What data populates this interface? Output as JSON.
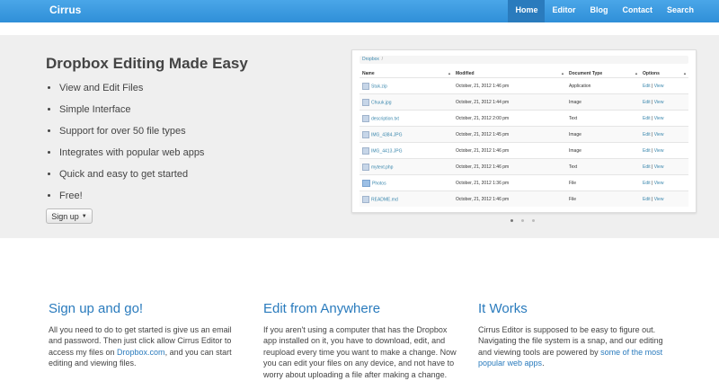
{
  "navbar": {
    "brand": "Cirrus",
    "links": [
      "Home",
      "Editor",
      "Blog",
      "Contact",
      "Search"
    ],
    "active": "Home"
  },
  "hero": {
    "title": "Dropbox Editing Made Easy",
    "features": [
      "View and Edit Files",
      "Simple Interface",
      "Support for over 50 file types",
      "Integrates with popular web apps",
      "Quick and easy to get started",
      "Free!"
    ],
    "signup_label": "Sign up",
    "carousel_active": 1,
    "carousel_count": 3
  },
  "file_browser": {
    "breadcrumb": "Dropbox",
    "columns": [
      "Name",
      "Modified",
      "Document Type",
      "Options"
    ],
    "rows": [
      {
        "name": "Stuk.zip",
        "modified": "October, 21, 2012 1:46 pm",
        "type": "Application",
        "edit": "Edit",
        "view": "View",
        "icon": "file-icon"
      },
      {
        "name": "Chuuk.jpg",
        "modified": "October, 21, 2012 1:44 pm",
        "type": "Image",
        "edit": "Edit",
        "view": "View",
        "icon": "image-icon"
      },
      {
        "name": "description.txt",
        "modified": "October, 21, 2012 2:00 pm",
        "type": "Text",
        "edit": "Edit",
        "view": "View",
        "icon": "file-icon"
      },
      {
        "name": "IMG_4384.JPG",
        "modified": "October, 21, 2012 1:45 pm",
        "type": "Image",
        "edit": "Edit",
        "view": "View",
        "icon": "image-icon"
      },
      {
        "name": "IMG_4413.JPG",
        "modified": "October, 21, 2012 1:46 pm",
        "type": "Image",
        "edit": "Edit",
        "view": "View",
        "icon": "image-icon"
      },
      {
        "name": "mytext.php",
        "modified": "October, 21, 2012 1:46 pm",
        "type": "Text",
        "edit": "Edit",
        "view": "View",
        "icon": "file-icon"
      },
      {
        "name": "Photos",
        "modified": "October, 21, 2012 1:36 pm",
        "type": "File",
        "edit": "Edit",
        "view": "View",
        "icon": "folder-icon"
      },
      {
        "name": "README.md",
        "modified": "October, 21, 2012 1:46 pm",
        "type": "File",
        "edit": "Edit",
        "view": "View",
        "icon": "file-icon"
      }
    ]
  },
  "sections": [
    {
      "title": "Sign up and go!",
      "text_before": "All you need to do to get started is give us an email and password. Then just click allow Cirrus Editor to access my files on ",
      "link": "Dropbox.com",
      "text_after": ", and you can start editing and viewing files."
    },
    {
      "title": "Edit from Anywhere",
      "text_before": "If you aren't using a computer that has the Dropbox app installed on it, you have to download, edit, and reupload every time you want to make a change. Now you can edit your files on any device, and not have to worry about uploading a file after making a change.",
      "link": "",
      "text_after": ""
    },
    {
      "title": "It Works",
      "text_before": "Cirrus Editor is supposed to be easy to figure out. Navigating the file system is a snap, and our editing and viewing tools are powered by ",
      "link": "some of the most popular web apps",
      "text_after": "."
    }
  ],
  "colors": {
    "navbar": "#3a9ae0",
    "nav_active": "#2a7bbd",
    "hero_bg": "#efefef",
    "heading_blue": "#2a7bbd"
  }
}
